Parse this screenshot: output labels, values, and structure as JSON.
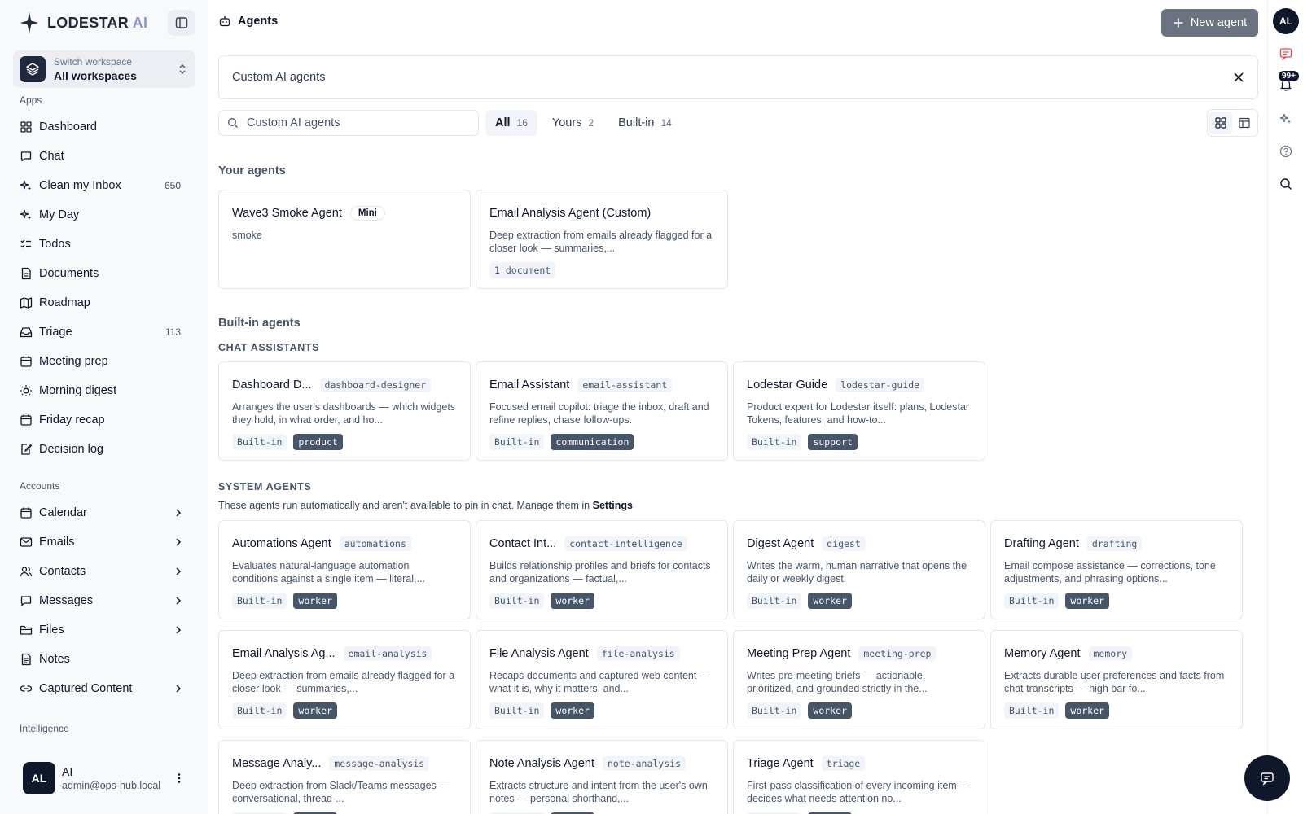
{
  "brand": {
    "name": "LODESTAR",
    "suffix": "AI"
  },
  "workspace": {
    "sub": "Switch workspace",
    "main": "All workspaces"
  },
  "apps": {
    "label": "Apps",
    "items": [
      {
        "label": "Dashboard",
        "count": "",
        "icon": "grid-icon"
      },
      {
        "label": "Chat",
        "count": "",
        "icon": "chat-icon"
      },
      {
        "label": "Clean my Inbox",
        "count": "650",
        "icon": "sparkles-icon"
      },
      {
        "label": "My Day",
        "count": "",
        "icon": "sparkles-icon"
      },
      {
        "label": "Todos",
        "count": "",
        "icon": "checklist-icon"
      },
      {
        "label": "Documents",
        "count": "",
        "icon": "document-icon"
      },
      {
        "label": "Roadmap",
        "count": "",
        "icon": "map-icon"
      },
      {
        "label": "Triage",
        "count": "113",
        "icon": "inbox-icon"
      },
      {
        "label": "Meeting prep",
        "count": "",
        "icon": "calendar-icon"
      },
      {
        "label": "Morning digest",
        "count": "",
        "icon": "sun-icon"
      },
      {
        "label": "Friday recap",
        "count": "",
        "icon": "calendar-icon"
      },
      {
        "label": "Decision log",
        "count": "",
        "icon": "edit-icon"
      }
    ]
  },
  "accounts": {
    "label": "Accounts",
    "items": [
      {
        "label": "Calendar",
        "arrow": true,
        "icon": "calendar-icon"
      },
      {
        "label": "Emails",
        "arrow": true,
        "icon": "mail-icon"
      },
      {
        "label": "Contacts",
        "arrow": true,
        "icon": "users-icon"
      },
      {
        "label": "Messages",
        "arrow": true,
        "icon": "message-icon"
      },
      {
        "label": "Files",
        "arrow": true,
        "icon": "folder-icon"
      },
      {
        "label": "Notes",
        "arrow": false,
        "icon": "note-icon"
      },
      {
        "label": "Captured Content",
        "arrow": true,
        "icon": "link-icon"
      }
    ]
  },
  "intelligence": {
    "label": "Intelligence"
  },
  "user": {
    "initials": "AL",
    "name": "AI",
    "email": "admin@ops-hub.local"
  },
  "header": {
    "title": "Agents",
    "new_button": "New agent"
  },
  "banner": {
    "text": "Custom AI agents"
  },
  "search": {
    "placeholder": "Custom AI agents"
  },
  "tabs": [
    {
      "label": "All",
      "count": "16"
    },
    {
      "label": "Yours",
      "count": "2"
    },
    {
      "label": "Built-in",
      "count": "14"
    }
  ],
  "sections": {
    "yours": "Your agents",
    "builtin": "Built-in agents",
    "chat": "CHAT ASSISTANTS",
    "system": "SYSTEM AGENTS",
    "system_note": "These agents run automatically and aren't available to pin in chat. Manage them in",
    "system_note_link": "Settings"
  },
  "your_agents": [
    {
      "title": "Wave3 Smoke Agent",
      "pill": "Mini",
      "desc": "smoke",
      "tags": []
    },
    {
      "title": "Email Analysis Agent (Custom)",
      "pill": "",
      "desc": "Deep extraction from emails already flagged for a closer look — summaries,...",
      "tags": [
        {
          "text": "1 document",
          "dark": false
        }
      ]
    }
  ],
  "chat_agents": [
    {
      "title": "Dashboard D...",
      "slug": "dashboard-designer",
      "desc": "Arranges the user's dashboards — which widgets they hold, in what order, and ho...",
      "tags": [
        {
          "text": "Built-in",
          "dark": false
        },
        {
          "text": "product",
          "dark": true
        }
      ]
    },
    {
      "title": "Email Assistant",
      "slug": "email-assistant",
      "desc": "Focused email copilot: triage the inbox, draft and refine replies, chase follow-ups.",
      "tags": [
        {
          "text": "Built-in",
          "dark": false
        },
        {
          "text": "communication",
          "dark": true
        }
      ]
    },
    {
      "title": "Lodestar Guide",
      "slug": "lodestar-guide",
      "desc": "Product expert for Lodestar itself: plans, Lodestar Tokens, features, and how-to...",
      "tags": [
        {
          "text": "Built-in",
          "dark": false
        },
        {
          "text": "support",
          "dark": true
        }
      ]
    }
  ],
  "system_agents": [
    {
      "title": "Automations Agent",
      "slug": "automations",
      "desc": "Evaluates natural-language automation conditions against a single item — literal,...",
      "tags": [
        {
          "text": "Built-in",
          "dark": false
        },
        {
          "text": "worker",
          "dark": true
        }
      ]
    },
    {
      "title": "Contact Int...",
      "slug": "contact-intelligence",
      "desc": "Builds relationship profiles and briefs for contacts and organizations — factual,...",
      "tags": [
        {
          "text": "Built-in",
          "dark": false
        },
        {
          "text": "worker",
          "dark": true
        }
      ]
    },
    {
      "title": "Digest Agent",
      "slug": "digest",
      "desc": "Writes the warm, human narrative that opens the daily or weekly digest.",
      "tags": [
        {
          "text": "Built-in",
          "dark": false
        },
        {
          "text": "worker",
          "dark": true
        }
      ]
    },
    {
      "title": "Drafting Agent",
      "slug": "drafting",
      "desc": "Email compose assistance — corrections, tone adjustments, and phrasing options...",
      "tags": [
        {
          "text": "Built-in",
          "dark": false
        },
        {
          "text": "worker",
          "dark": true
        }
      ]
    },
    {
      "title": "Email Analysis Ag...",
      "slug": "email-analysis",
      "desc": "Deep extraction from emails already flagged for a closer look — summaries,...",
      "tags": [
        {
          "text": "Built-in",
          "dark": false
        },
        {
          "text": "worker",
          "dark": true
        }
      ]
    },
    {
      "title": "File Analysis Agent",
      "slug": "file-analysis",
      "desc": "Recaps documents and captured web content — what it is, why it matters, and...",
      "tags": [
        {
          "text": "Built-in",
          "dark": false
        },
        {
          "text": "worker",
          "dark": true
        }
      ]
    },
    {
      "title": "Meeting Prep Agent",
      "slug": "meeting-prep",
      "desc": "Writes pre-meeting briefs — actionable, prioritized, and grounded strictly in the...",
      "tags": [
        {
          "text": "Built-in",
          "dark": false
        },
        {
          "text": "worker",
          "dark": true
        }
      ]
    },
    {
      "title": "Memory Agent",
      "slug": "memory",
      "desc": "Extracts durable user preferences and facts from chat transcripts — high bar fo...",
      "tags": [
        {
          "text": "Built-in",
          "dark": false
        },
        {
          "text": "worker",
          "dark": true
        }
      ]
    },
    {
      "title": "Message Analy...",
      "slug": "message-analysis",
      "desc": "Deep extraction from Slack/Teams messages — conversational, thread-...",
      "tags": [
        {
          "text": "Built-in",
          "dark": false
        },
        {
          "text": "worker",
          "dark": true
        }
      ]
    },
    {
      "title": "Note Analysis Agent",
      "slug": "note-analysis",
      "desc": "Extracts structure and intent from the user's own notes — personal shorthand,...",
      "tags": [
        {
          "text": "Built-in",
          "dark": false
        },
        {
          "text": "worker",
          "dark": true
        }
      ]
    },
    {
      "title": "Triage Agent",
      "slug": "triage",
      "desc": "First-pass classification of every incoming item — decides what needs attention no...",
      "tags": [
        {
          "text": "Built-in",
          "dark": false
        },
        {
          "text": "worker",
          "dark": true
        }
      ]
    }
  ],
  "rail": {
    "avatar": "AL",
    "notif_badge": "99+"
  }
}
